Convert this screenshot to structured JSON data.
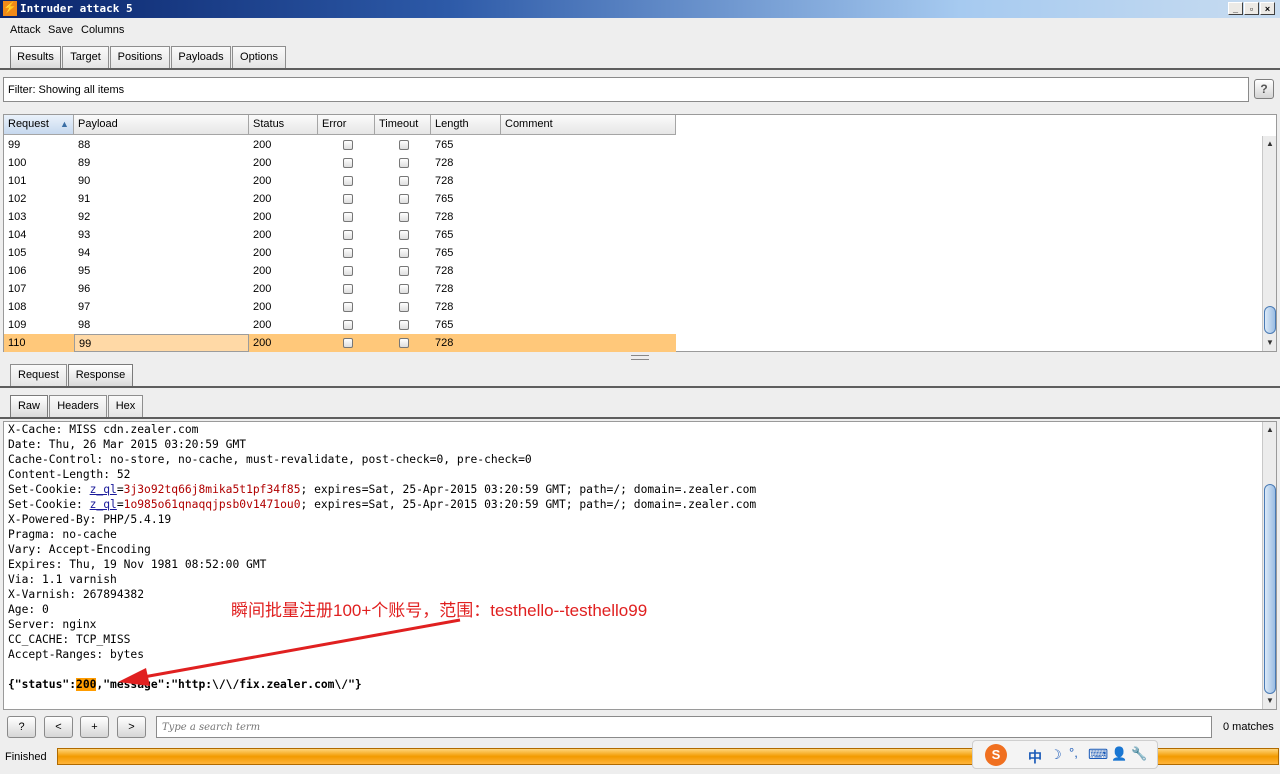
{
  "window": {
    "title": "Intruder attack 5",
    "controls": [
      "_",
      "▫",
      "×"
    ]
  },
  "menu": [
    "Attack",
    "Save",
    "Columns"
  ],
  "main_tabs": [
    {
      "label": "Results",
      "selected": true
    },
    {
      "label": "Target",
      "selected": false
    },
    {
      "label": "Positions",
      "selected": false
    },
    {
      "label": "Payloads",
      "selected": false
    },
    {
      "label": "Options",
      "selected": false
    }
  ],
  "filter": {
    "text": "Filter:  Showing all items",
    "help": "?"
  },
  "table": {
    "columns": [
      "Request",
      "Payload",
      "Status",
      "Error",
      "Timeout",
      "Length",
      "Comment"
    ],
    "sort_indicator": "▲",
    "rows": [
      {
        "request": "99",
        "payload": "88",
        "status": "200",
        "length": "765"
      },
      {
        "request": "100",
        "payload": "89",
        "status": "200",
        "length": "728"
      },
      {
        "request": "101",
        "payload": "90",
        "status": "200",
        "length": "728"
      },
      {
        "request": "102",
        "payload": "91",
        "status": "200",
        "length": "765"
      },
      {
        "request": "103",
        "payload": "92",
        "status": "200",
        "length": "728"
      },
      {
        "request": "104",
        "payload": "93",
        "status": "200",
        "length": "765"
      },
      {
        "request": "105",
        "payload": "94",
        "status": "200",
        "length": "765"
      },
      {
        "request": "106",
        "payload": "95",
        "status": "200",
        "length": "728"
      },
      {
        "request": "107",
        "payload": "96",
        "status": "200",
        "length": "728"
      },
      {
        "request": "108",
        "payload": "97",
        "status": "200",
        "length": "728"
      },
      {
        "request": "109",
        "payload": "98",
        "status": "200",
        "length": "765"
      },
      {
        "request": "110",
        "payload": "99",
        "status": "200",
        "length": "728"
      }
    ],
    "selected_request": "110"
  },
  "detail_tabs": [
    {
      "label": "Request",
      "selected": false
    },
    {
      "label": "Response",
      "selected": true
    }
  ],
  "view_tabs": [
    {
      "label": "Raw",
      "selected": true
    },
    {
      "label": "Headers",
      "selected": false
    },
    {
      "label": "Hex",
      "selected": false
    }
  ],
  "response": {
    "lines": [
      "X-Cache: MISS cdn.zealer.com",
      "Date: Thu, 26 Mar 2015 03:20:59 GMT",
      "Cache-Control: no-store, no-cache, must-revalidate, post-check=0, pre-check=0",
      "Content-Length: 52"
    ],
    "cookie1": {
      "prefix": "Set-Cookie: ",
      "name": "z_ql",
      "value": "3j3o92tq66j8mika5t1pf34f85",
      "suffix": "; expires=Sat, 25-Apr-2015 03:20:59 GMT; path=/; domain=.zealer.com"
    },
    "cookie2": {
      "prefix": "Set-Cookie: ",
      "name": "z_ql",
      "value": "1o985o61qnaqqjpsb0v1471ou0",
      "suffix": "; expires=Sat, 25-Apr-2015 03:20:59 GMT; path=/; domain=.zealer.com"
    },
    "lines2": [
      "X-Powered-By: PHP/5.4.19",
      "Pragma: no-cache",
      "Vary: Accept-Encoding",
      "Expires: Thu, 19 Nov 1981 08:52:00 GMT",
      "Via: 1.1 varnish",
      "X-Varnish: 267894382",
      "Age: 0",
      "Server: nginx",
      "CC_CACHE: TCP_MISS",
      "Accept-Ranges: bytes"
    ],
    "json_prefix": "{\"status\":",
    "json_status": "200",
    "json_suffix": ",\"message\":\"http:\\/\\/fix.zealer.com\\/\"}"
  },
  "annotation": "瞬间批量注册100+个账号，范围：testhello--testhello99",
  "search": {
    "buttons": [
      "?",
      "<",
      "+",
      ">"
    ],
    "placeholder": "Type a search term",
    "matches": "0 matches"
  },
  "status": {
    "text": "Finished",
    "progress": 1.0
  },
  "ime_icons": [
    "S",
    "中",
    "☽",
    "°,",
    "⌨",
    "👤",
    "🔧"
  ],
  "colors": {
    "selected_row": "#ffc87a",
    "progress": "#f29a00",
    "annotation": "#e02020",
    "cookie_value": "#b00000"
  }
}
